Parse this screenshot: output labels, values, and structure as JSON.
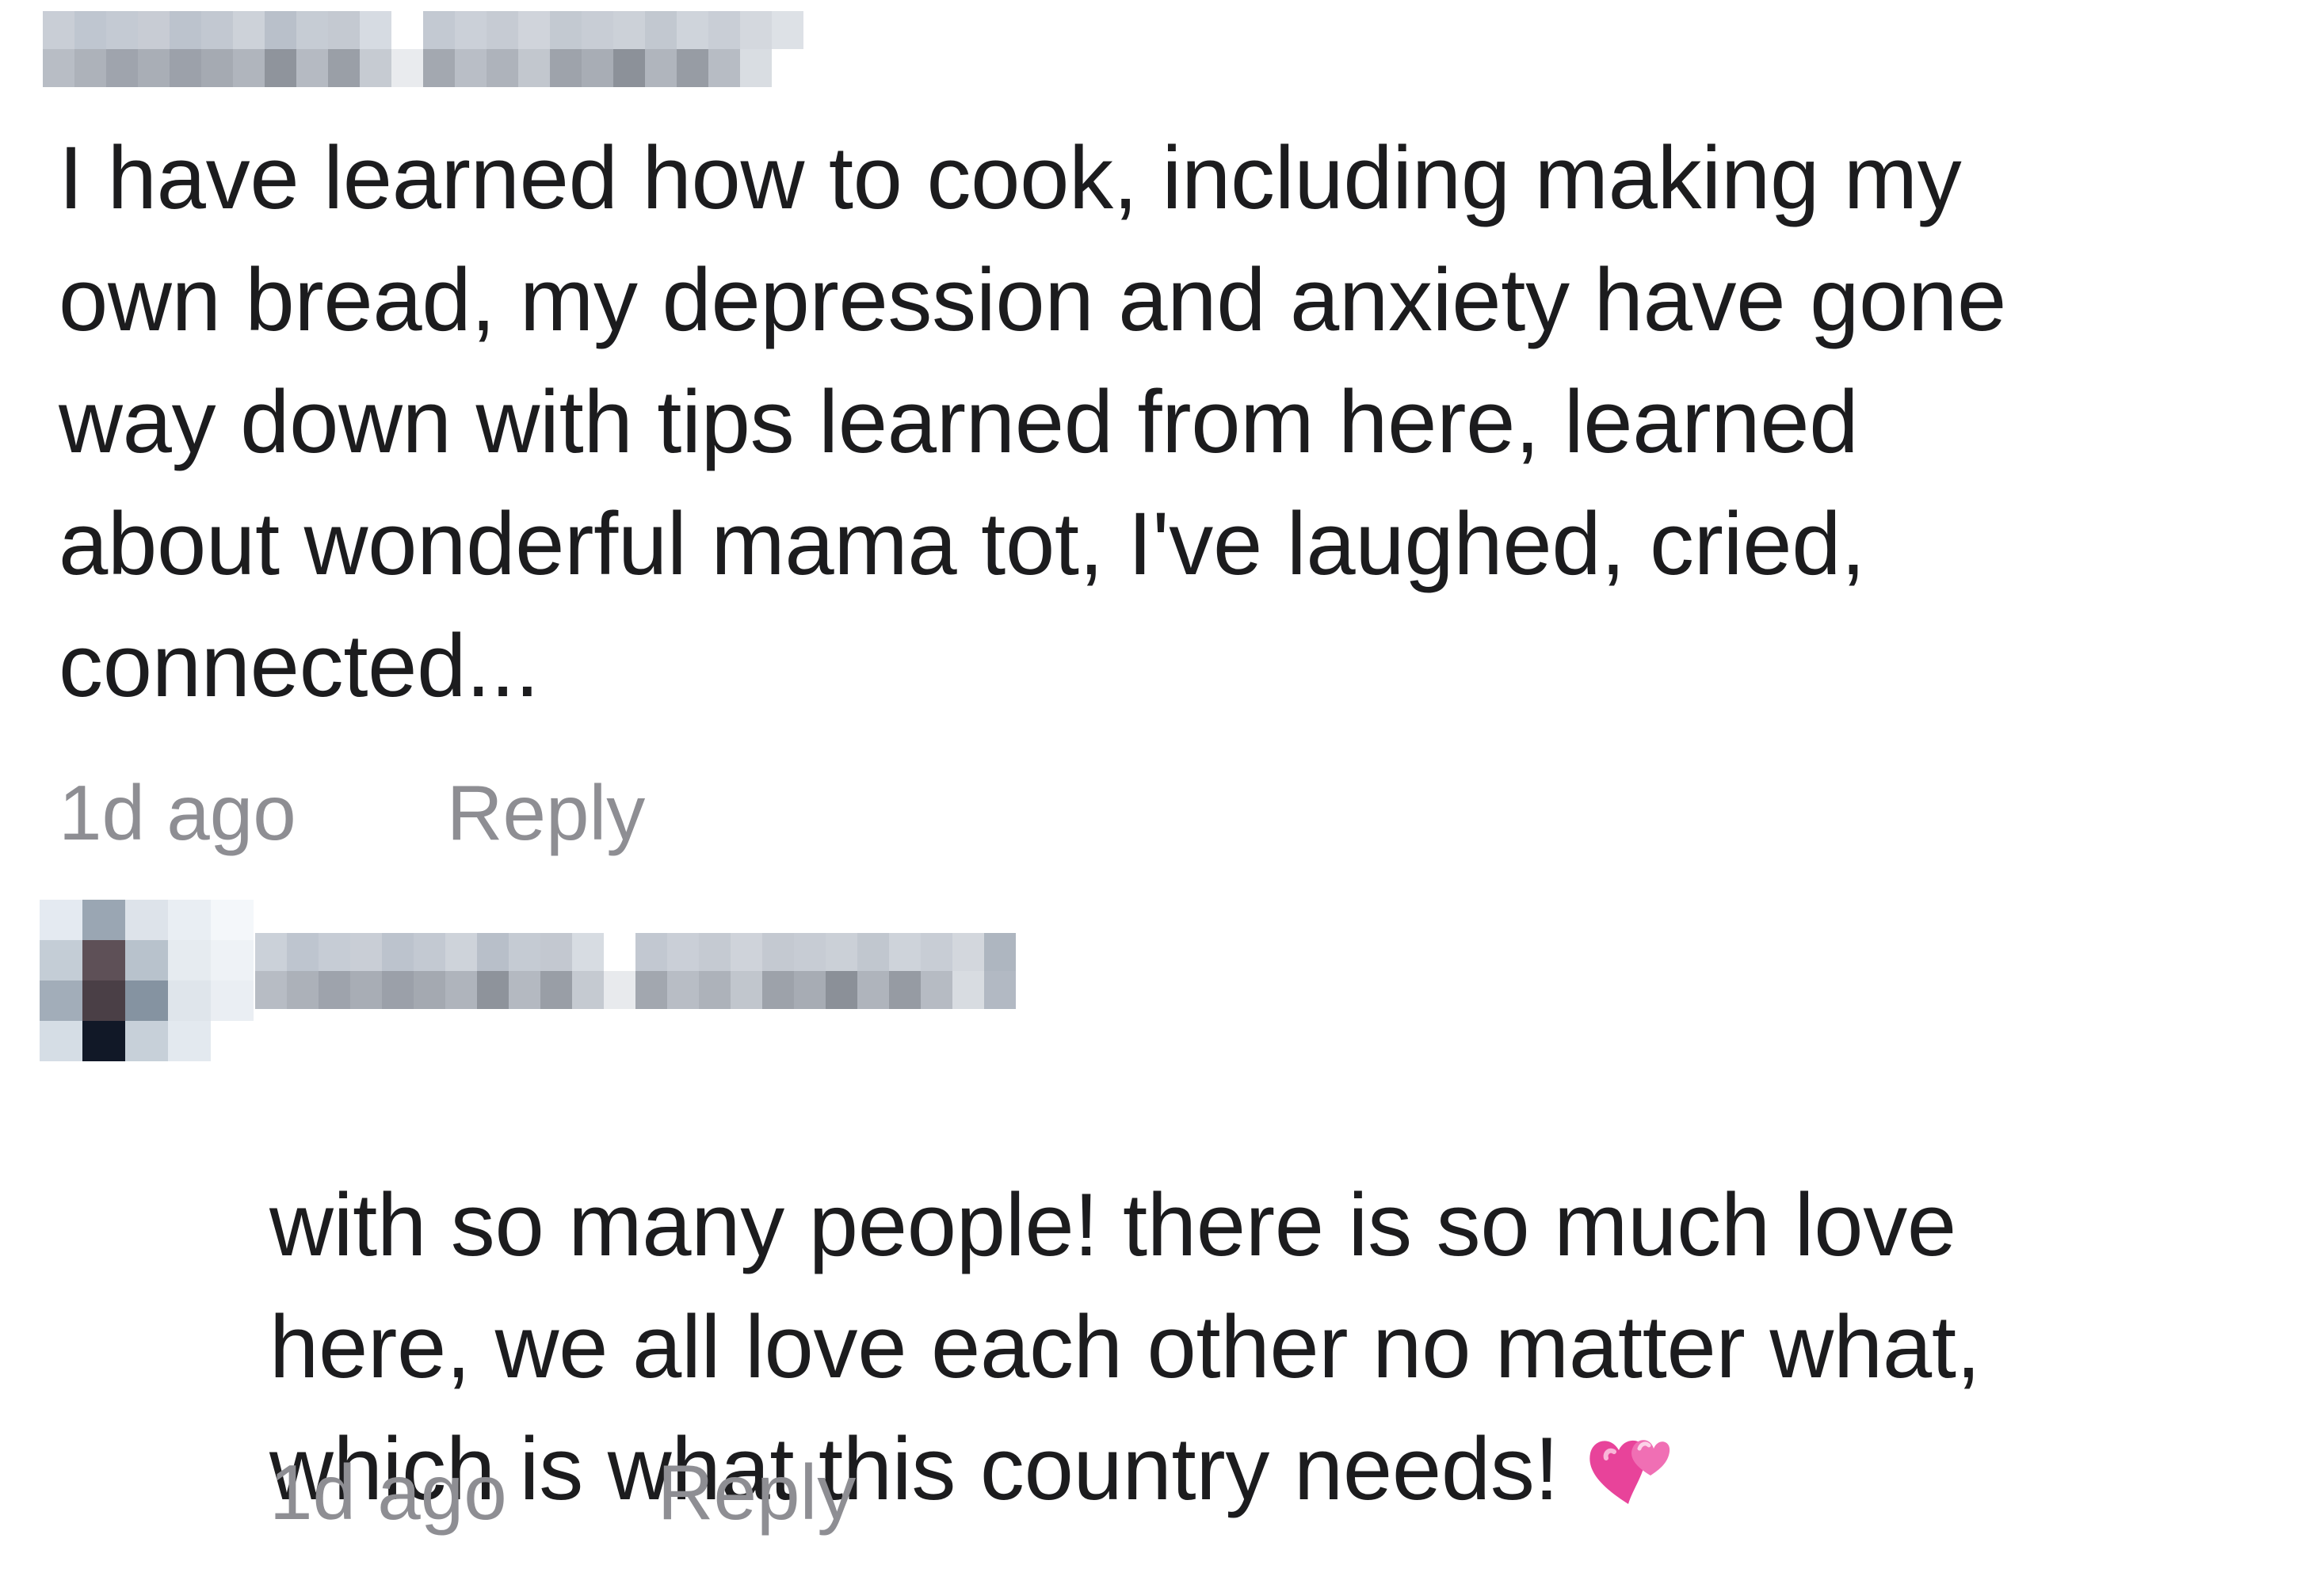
{
  "comments": [
    {
      "text": "I have learned how to cook, including making my\nown bread, my depression and anxiety have gone\nway down with tips learned from here, learned\nabout wonderful mama tot, I've laughed, cried,\nconnected...",
      "timestamp": "1d ago",
      "reply_label": "Reply"
    },
    {
      "text": "with so many people! there is so much love\nhere, we all love each other no matter what,\nwhich is what this country needs!",
      "emoji_icon": "two-hearts-icon",
      "timestamp": "1d ago",
      "reply_label": "Reply"
    }
  ],
  "colors": {
    "text": "#1c1c1e",
    "meta": "#8e8e93",
    "emoji_pink": "#e8439a"
  }
}
